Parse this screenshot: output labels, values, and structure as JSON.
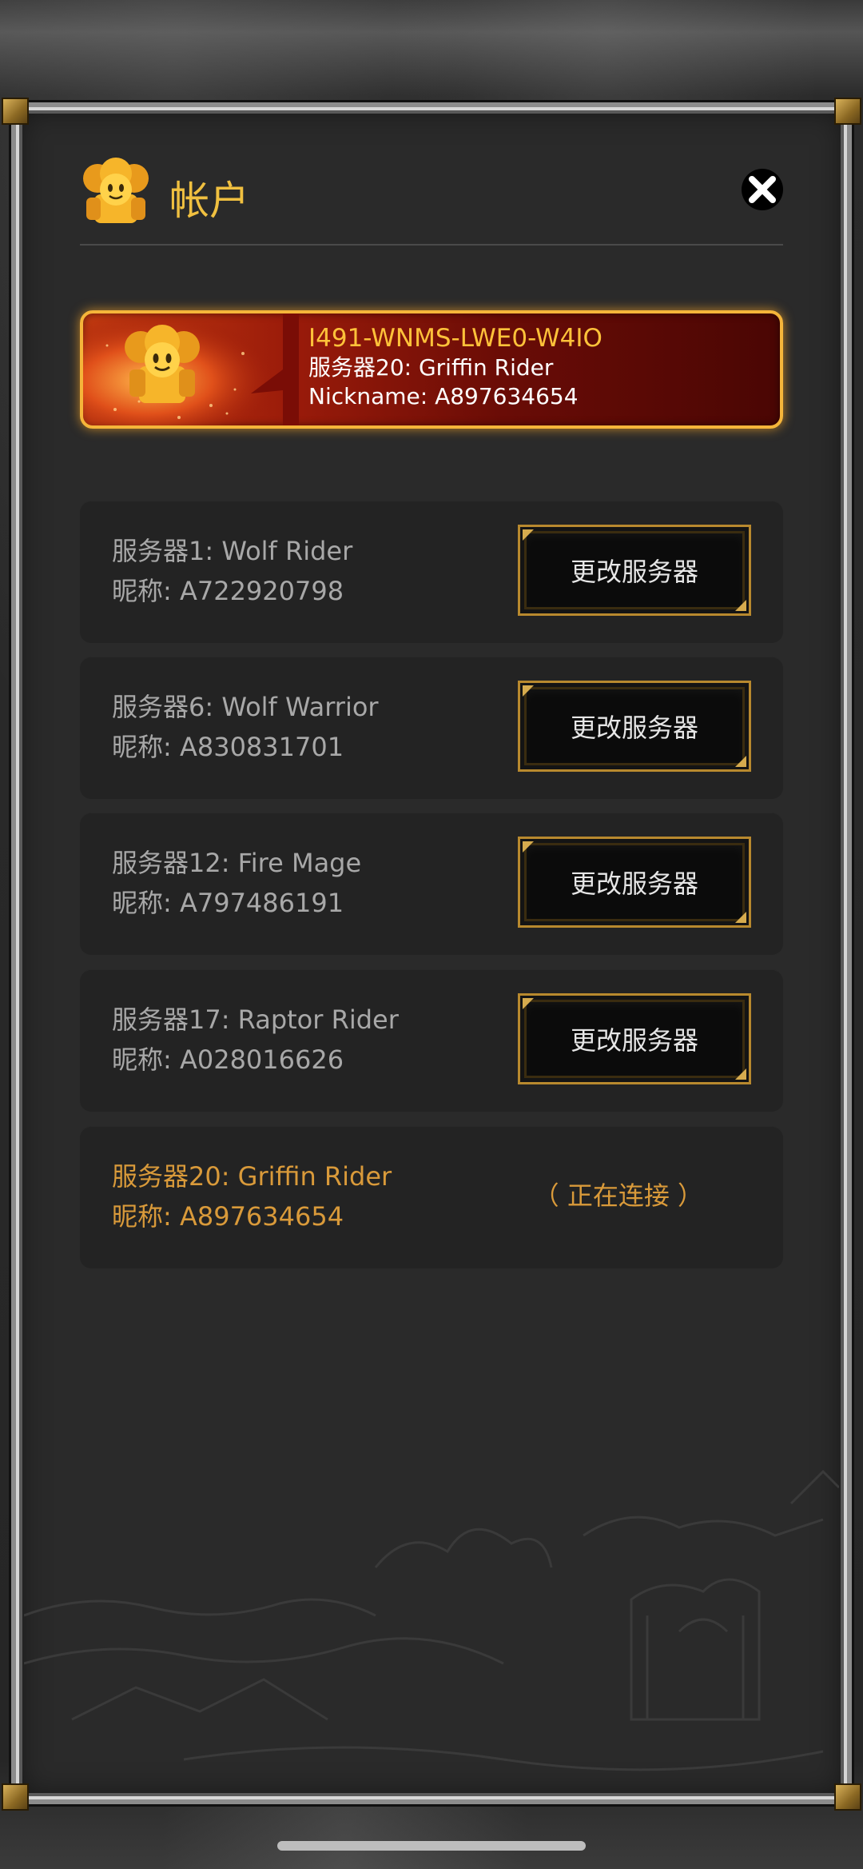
{
  "header": {
    "title": "帐户",
    "icon": "mascot-icon",
    "close_icon": "close-icon"
  },
  "current_account": {
    "id": "I491-WNMS-LWE0-W4IO",
    "server": "服务器20: Griffin Rider",
    "nickname": "Nickname: A897634654"
  },
  "servers": [
    {
      "name": "服务器1: Wolf Rider",
      "nickname": "昵称: A722920798",
      "action": "更改服务器"
    },
    {
      "name": "服务器6: Wolf Warrior",
      "nickname": "昵称: A830831701",
      "action": "更改服务器"
    },
    {
      "name": "服务器12: Fire Mage",
      "nickname": "昵称: A797486191",
      "action": "更改服务器"
    },
    {
      "name": "服务器17: Raptor Rider",
      "nickname": "昵称: A028016626",
      "action": "更改服务器"
    },
    {
      "name": "服务器20: Griffin Rider",
      "nickname": "昵称: A897634654",
      "status": "（ 正在连接 ）"
    }
  ],
  "colors": {
    "accent_gold": "#f0c040",
    "active_orange": "#d99a3a",
    "card_red": "#9a1b0a"
  }
}
